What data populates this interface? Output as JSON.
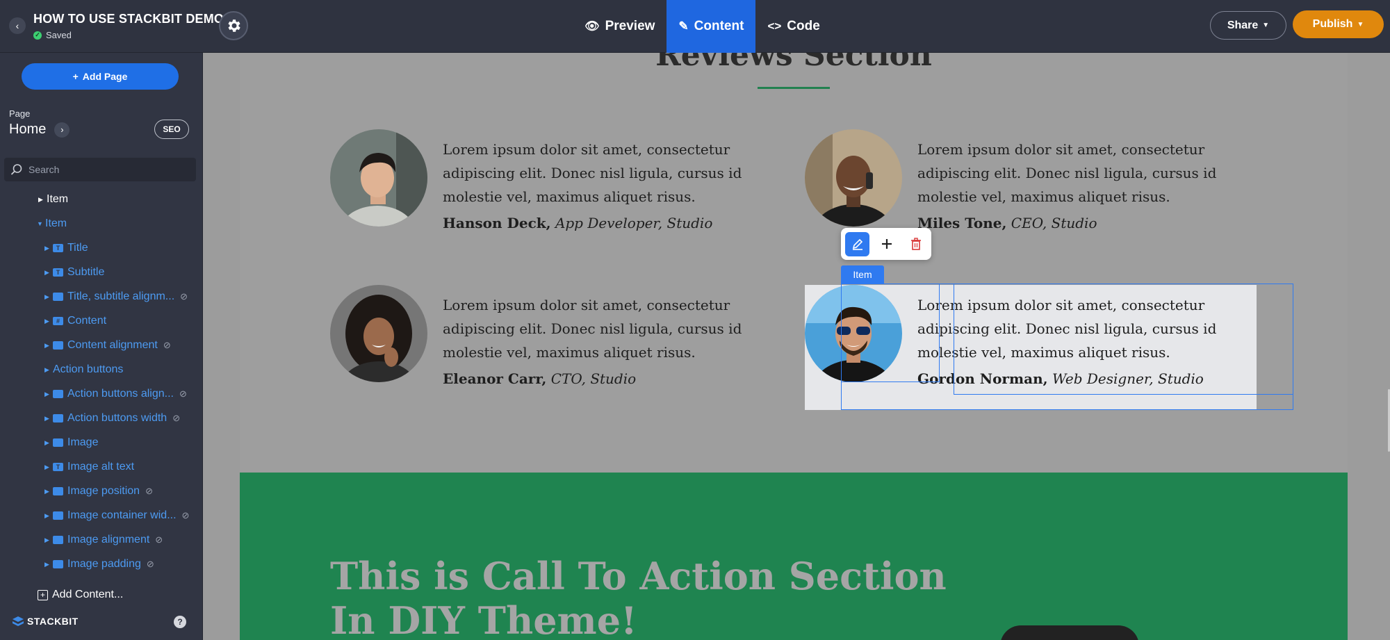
{
  "topbar": {
    "project_title": "HOW TO USE STACKBIT DEMO",
    "status": "Saved",
    "tabs": [
      {
        "label": "Preview",
        "icon": "eye-icon"
      },
      {
        "label": "Content",
        "icon": "pencil-icon",
        "active": true
      },
      {
        "label": "Code",
        "icon": "code-icon"
      }
    ],
    "share_label": "Share",
    "publish_label": "Publish"
  },
  "sidebar": {
    "add_page_label": "Add Page",
    "page_label": "Page",
    "page_name": "Home",
    "seo_label": "SEO",
    "search_placeholder": "Search",
    "tree": [
      {
        "label": "Item",
        "expanded": false
      },
      {
        "label": "Item",
        "expanded": true
      },
      {
        "label": "Title",
        "type": "text"
      },
      {
        "label": "Subtitle",
        "type": "text"
      },
      {
        "label": "Title, subtitle alignm...",
        "type": "enum",
        "hidden": true
      },
      {
        "label": "Content",
        "type": "markdown"
      },
      {
        "label": "Content alignment",
        "type": "enum",
        "hidden": true
      },
      {
        "label": "Action buttons",
        "type": "list"
      },
      {
        "label": "Action buttons align...",
        "type": "enum",
        "hidden": true
      },
      {
        "label": "Action buttons width",
        "type": "enum",
        "hidden": true
      },
      {
        "label": "Image",
        "type": "image"
      },
      {
        "label": "Image alt text",
        "type": "text"
      },
      {
        "label": "Image position",
        "type": "enum",
        "hidden": true
      },
      {
        "label": "Image container wid...",
        "type": "enum",
        "hidden": true
      },
      {
        "label": "Image alignment",
        "type": "enum",
        "hidden": true
      },
      {
        "label": "Image padding",
        "type": "object",
        "hidden": true
      }
    ],
    "add_content_label": "Add Content...",
    "logo_text": "STACKBIT"
  },
  "canvas": {
    "section_title": "Reviews Section",
    "reviews": [
      {
        "quote": "Lorem ipsum dolor sit amet, consectetur adipiscing elit. Donec nisl ligula, cursus id molestie vel, maximus aliquet risus.",
        "name": "Hanson Deck,",
        "role": "App Developer, Studio"
      },
      {
        "quote": "Lorem ipsum dolor sit amet, consectetur adipiscing elit. Donec nisl ligula, cursus id molestie vel, maximus aliquet risus.",
        "name": "Miles Tone,",
        "role": "CEO, Studio"
      },
      {
        "quote": "Lorem ipsum dolor sit amet, consectetur adipiscing elit. Donec nisl ligula, cursus id molestie vel, maximus aliquet risus.",
        "name": "Eleanor Carr,",
        "role": "CTO, Studio"
      },
      {
        "quote": "Lorem ipsum dolor sit amet, consectetur adipiscing elit. Donec nisl ligula, cursus id molestie vel, maximus aliquet risus.",
        "name": "Gordon Norman,",
        "role": "Web Designer, Studio"
      }
    ],
    "selection_tag": "Item",
    "cta_title": "This is Call To Action Section In DIY Theme!"
  },
  "colors": {
    "topbar_bg": "#2f3340",
    "accent_blue": "#1f67e0",
    "publish_orange": "#e0880d",
    "cta_green": "#1f8450"
  }
}
